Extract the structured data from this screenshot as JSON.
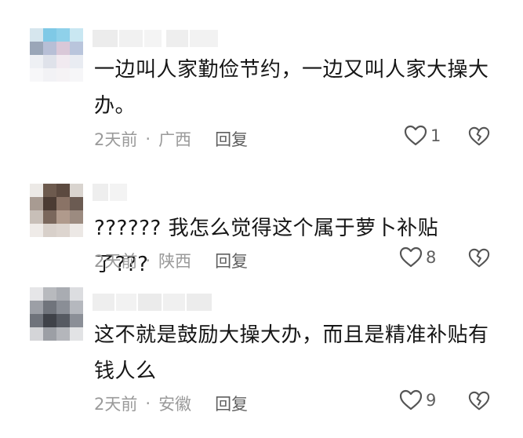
{
  "comments": [
    {
      "text": "一边叫人家勤俭节约，一边又叫人家大操大办。",
      "time": "2天前",
      "separator": "·",
      "location": "广西",
      "reply_label": "回复",
      "like_count": "1"
    },
    {
      "text": "?????? 我怎么觉得这个属于萝卜补贴了???",
      "time": "2天前",
      "separator": "·",
      "location": "陕西",
      "reply_label": "回复",
      "like_count": "8"
    },
    {
      "text": "这不就是鼓励大操大办，而且是精准补贴有钱人么",
      "time": "2天前",
      "separator": "·",
      "location": "安徽",
      "reply_label": "回复",
      "like_count": "9"
    }
  ],
  "icons": {
    "like": "heart-outline-icon",
    "dislike": "broken-heart-icon"
  },
  "colors": {
    "meta_text": "#9a9a9a",
    "action_text": "#5f5f5f",
    "body_text": "#161616"
  }
}
